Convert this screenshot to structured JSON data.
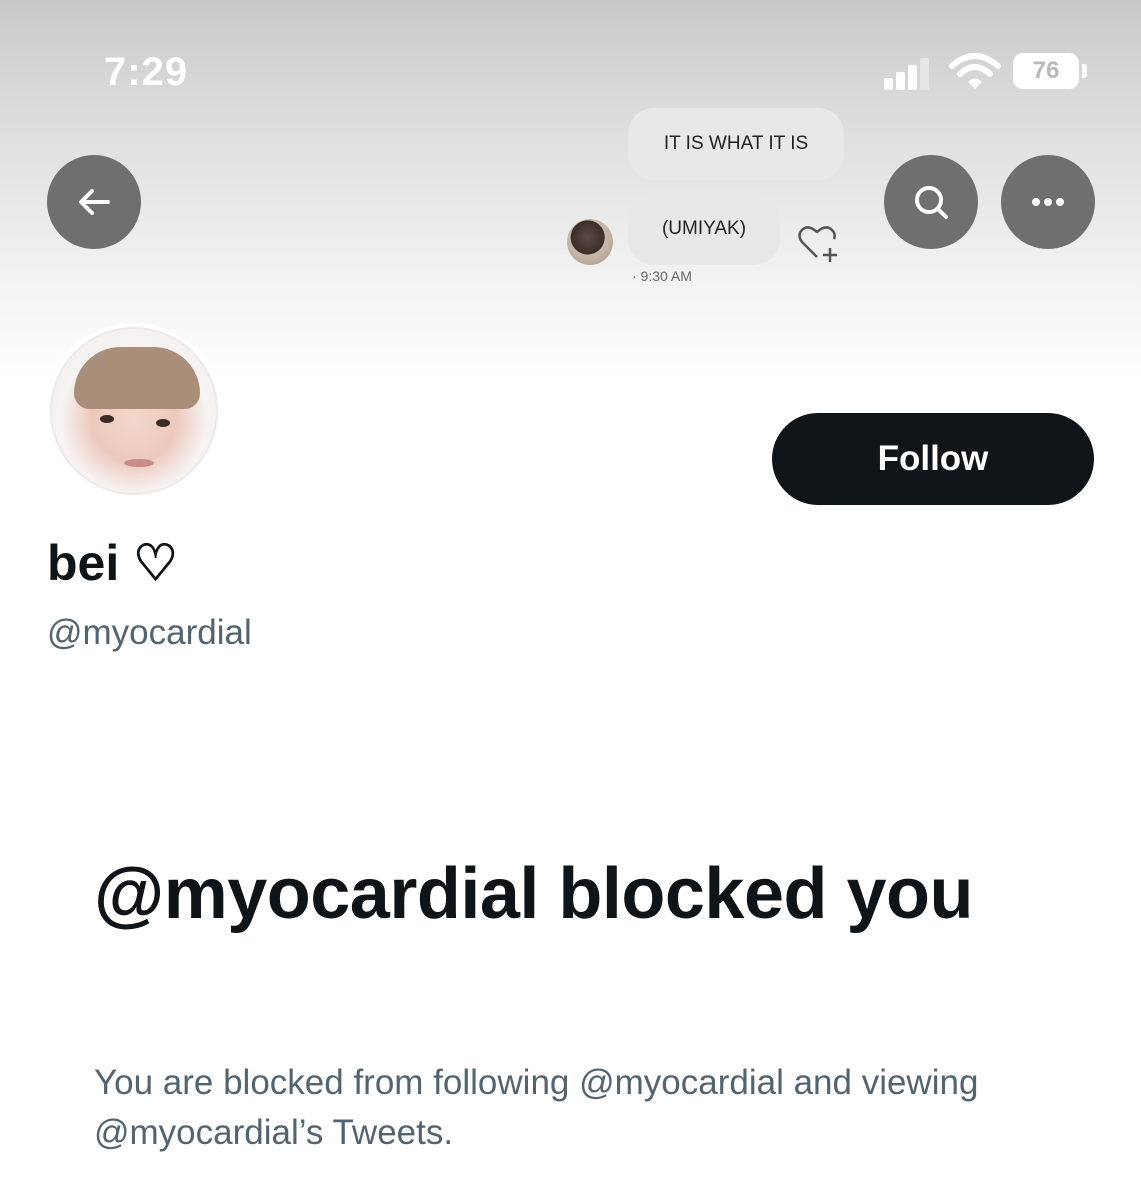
{
  "status_bar": {
    "time": "7:29",
    "battery": "76"
  },
  "banner": {
    "messages": [
      "IT IS WHAT IT IS",
      "(UMIYAK)"
    ],
    "message_time": "· 9:30 AM"
  },
  "toolbar": {
    "back_icon": "arrow-left-icon",
    "search_icon": "search-icon",
    "more_icon": "more-horizontal-icon"
  },
  "profile": {
    "display_name": "bei ♡",
    "handle": "@myocardial",
    "follow_label": "Follow"
  },
  "blocked": {
    "title": "@myocardial blocked you",
    "description": "You are blocked from following @myocardial and viewing @myocardial’s Tweets."
  },
  "colors": {
    "primary_text": "#0f1419",
    "secondary_text": "#536471",
    "button_bg": "#0f1419",
    "circle_button_bg": "#6f6f6f"
  }
}
